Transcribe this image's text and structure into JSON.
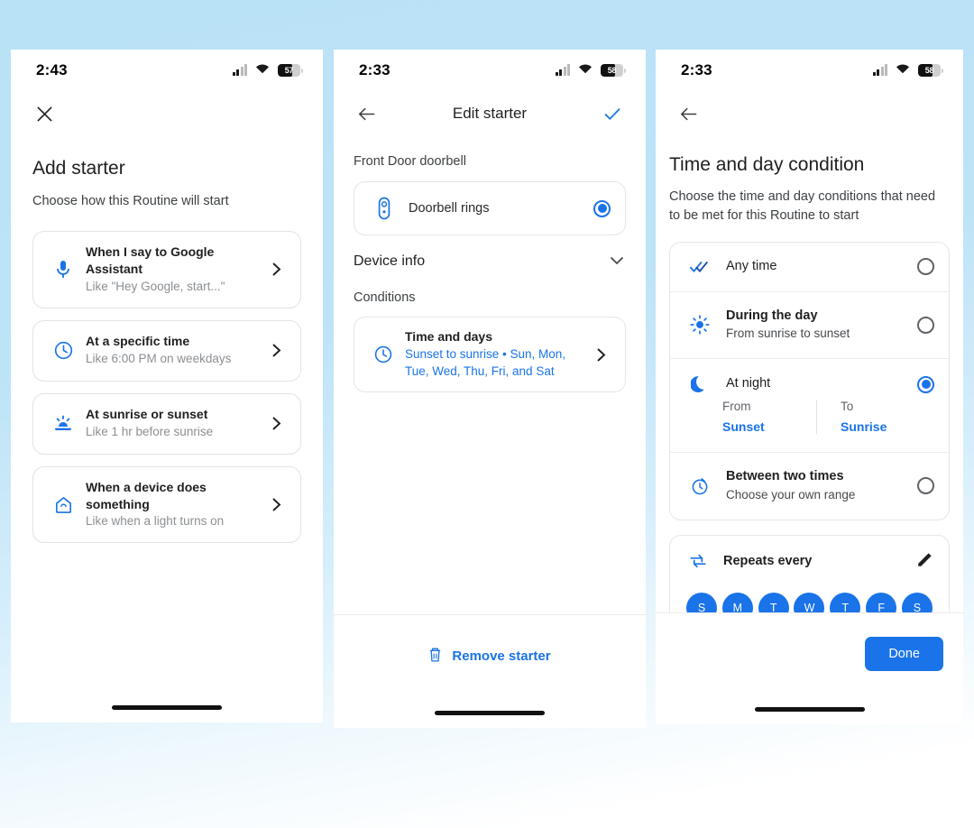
{
  "theme": {
    "accent": "#1a73e8",
    "background": "#bae2f7",
    "panel": "#ffffff",
    "muted": "#8b8f93"
  },
  "panel1": {
    "status": {
      "time": "2:43",
      "battery": "57",
      "signal_icon": "cellular-signal-icon",
      "wifi_icon": "wifi-icon",
      "battery_icon": "battery-icon"
    },
    "close_icon": "close-icon",
    "title": "Add starter",
    "subtitle": "Choose how this Routine will start",
    "options": [
      {
        "icon": "microphone-icon",
        "title": "When I say to Google Assistant",
        "subtitle": "Like \"Hey Google, start...\"",
        "chevron": "chevron-right-icon"
      },
      {
        "icon": "clock-icon",
        "title": "At a specific time",
        "subtitle": "Like 6:00 PM on weekdays",
        "chevron": "chevron-right-icon"
      },
      {
        "icon": "sunrise-sunset-icon",
        "title": "At sunrise or sunset",
        "subtitle": "Like 1 hr before sunrise",
        "chevron": "chevron-right-icon"
      },
      {
        "icon": "home-device-icon",
        "title": "When a device does something",
        "subtitle": "Like when a light turns on",
        "chevron": "chevron-right-icon"
      }
    ]
  },
  "panel2": {
    "status": {
      "time": "2:33",
      "battery": "58"
    },
    "back_icon": "back-arrow-icon",
    "nav_title": "Edit starter",
    "confirm_icon": "checkmark-icon",
    "device_label": "Front Door doorbell",
    "trigger": {
      "icon": "doorbell-icon",
      "label": "Doorbell rings",
      "selected": true
    },
    "device_info": {
      "label": "Device info",
      "chevron": "chevron-down-icon"
    },
    "conditions_label": "Conditions",
    "condition": {
      "icon": "clock-icon",
      "title": "Time and days",
      "value": "Sunset to sunrise • Sun, Mon, Tue, Wed, Thu, Fri, and Sat",
      "chevron": "chevron-right-icon"
    },
    "remove": {
      "icon": "trash-icon",
      "label": "Remove starter"
    }
  },
  "panel3": {
    "status": {
      "time": "2:33",
      "battery": "58"
    },
    "back_icon": "back-arrow-icon",
    "title": "Time and day condition",
    "subtitle": "Choose the time and day conditions that need to be met for this Routine to start",
    "options": [
      {
        "icon": "double-check-icon",
        "title": "Any time",
        "subtitle": "",
        "selected": false
      },
      {
        "icon": "sun-icon",
        "title": "During the day",
        "subtitle": "From sunrise to sunset",
        "selected": false
      },
      {
        "icon": "moon-icon",
        "title": "At night",
        "subtitle": "",
        "selected": true
      },
      {
        "icon": "timer-icon",
        "title": "Between two times",
        "subtitle": "Choose your own range",
        "selected": false
      }
    ],
    "night_range": {
      "from_label": "From",
      "from_value": "Sunset",
      "to_label": "To",
      "to_value": "Sunrise"
    },
    "repeat": {
      "icon": "repeat-icon",
      "label": "Repeats every",
      "edit_icon": "pencil-icon",
      "days": [
        {
          "letter": "S",
          "name": "Sunday",
          "on": true
        },
        {
          "letter": "M",
          "name": "Monday",
          "on": true
        },
        {
          "letter": "T",
          "name": "Tuesday",
          "on": true
        },
        {
          "letter": "W",
          "name": "Wednesday",
          "on": true
        },
        {
          "letter": "T",
          "name": "Thursday",
          "on": true
        },
        {
          "letter": "F",
          "name": "Friday",
          "on": true
        },
        {
          "letter": "S",
          "name": "Saturday",
          "on": true
        }
      ]
    },
    "done_label": "Done"
  }
}
